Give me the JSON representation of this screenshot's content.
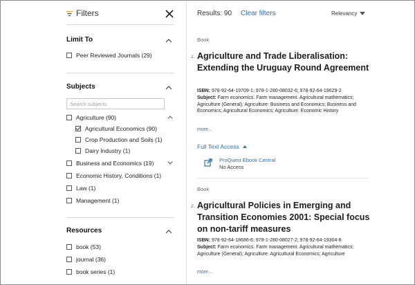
{
  "sidebar": {
    "title": "Filters",
    "limit_to": {
      "title": "Limit To",
      "items": [
        {
          "label": "Peer Reviewed Journals (29)",
          "checked": false
        }
      ]
    },
    "subjects": {
      "title": "Subjects",
      "search_placeholder": "Search subjects",
      "items": [
        {
          "label": "Agriculture (90)",
          "checked": false,
          "expanded": true
        },
        {
          "label": "Agricultural Economics (90)",
          "checked": true
        },
        {
          "label": "Crop Production and Soils (1)",
          "checked": false
        },
        {
          "label": "Dairy Industry (1)",
          "checked": false
        },
        {
          "label": "Business and Economics (19)",
          "checked": false,
          "expanded": false
        },
        {
          "label": "Economic History, Conditions (1)",
          "checked": false
        },
        {
          "label": "Law (1)",
          "checked": false
        },
        {
          "label": "Management (1)",
          "checked": false
        }
      ]
    },
    "resources": {
      "title": "Resources",
      "items": [
        {
          "label": "book (53)",
          "checked": false
        },
        {
          "label": "journal (36)",
          "checked": false
        },
        {
          "label": "book series (1)",
          "checked": false
        }
      ]
    }
  },
  "results_bar": {
    "count": "Results: 90",
    "clear": "Clear filters",
    "sort": "Relevancy"
  },
  "results": [
    {
      "number": "1.",
      "type": "Book",
      "title": "Agriculture and Trade Liberalisation: Extending the Uruguay Round Agreement",
      "isbn_label": "ISBN:",
      "isbn": "978-92-64-19709-1; 978-1-280-08032-6; 978-92-64-19629-2",
      "subject_label": "Subject:",
      "subject": "Farm economics. Farm management. Agricultural mathematics; Agriculture (General); Agriculture: Business and Economics; Business and Economics; Agricultural Economics; Agriculture: Economic History",
      "more": "more...",
      "full_text": "Full Text Access",
      "provider": "ProQuest Ebook Central",
      "access": "No Access"
    },
    {
      "number": "2.",
      "type": "Book",
      "title": "Agricultural Policies in Emerging and Transition Economies 2001: Special focus on non-tariff measures",
      "isbn_label": "ISBN:",
      "isbn": "978-92-64-18686-6; 978-1-280-08027-2; 978-92-64-19304-8",
      "subject_label": "Subject:",
      "subject": "Farm economics. Farm management. Agricultural mathematics; Agriculture (General); Agriculture: Agricultural Economics; Agriculture",
      "more": "more..."
    }
  ],
  "colors": {
    "link": "#2f6fb2",
    "filter_icon": "#e8a33a"
  }
}
